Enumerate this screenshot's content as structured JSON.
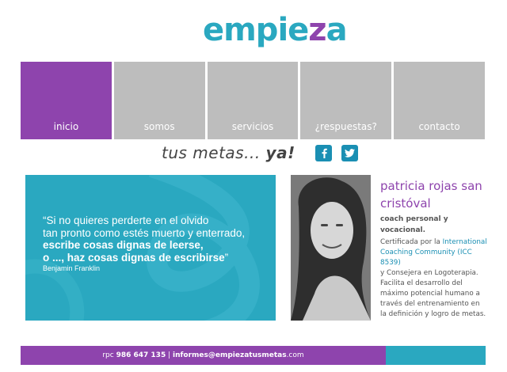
{
  "logo": {
    "part1": "empie",
    "part2": "z",
    "part3": "a"
  },
  "nav": {
    "items": [
      {
        "label": "inicio",
        "active": true
      },
      {
        "label": "somos"
      },
      {
        "label": "servicios"
      },
      {
        "label": "¿respuestas?"
      },
      {
        "label": "contacto"
      }
    ]
  },
  "tagline": {
    "light": "tus metas... ",
    "bold": "ya!"
  },
  "social": {
    "facebook_icon": "facebook-icon",
    "twitter_icon": "twitter-icon"
  },
  "quote": {
    "line1": "“Si no quieres perderte en el olvido",
    "line2": "tan pronto como estés muerto y enterrado,",
    "line3": "escribe cosas dignas de leerse,",
    "line4": "o ..., haz cosas dignas de escribirse",
    "line4_end": "”",
    "author": "Benjamin Franklin"
  },
  "bio": {
    "name": "patricia rojas san cristóval",
    "role": "coach personal y vocacional.",
    "text_start": "Certificada por la ",
    "link": "International Coaching Community (ICC 8539)",
    "text_end": "y Consejera en Logoterapia. Facilita el desarrollo del máximo potencial humano a través del entrenamiento en la definición y logro de metas."
  },
  "footer": {
    "prefix": "rpc ",
    "phone": "986 647 135",
    "sep": " | ",
    "email": "informes@empiezatusmetas",
    "email_end": ".com"
  },
  "colors": {
    "purple": "#8e44ad",
    "teal": "#2aa8c0",
    "gray": "#bdbdbd",
    "social": "#1a8fb3"
  }
}
